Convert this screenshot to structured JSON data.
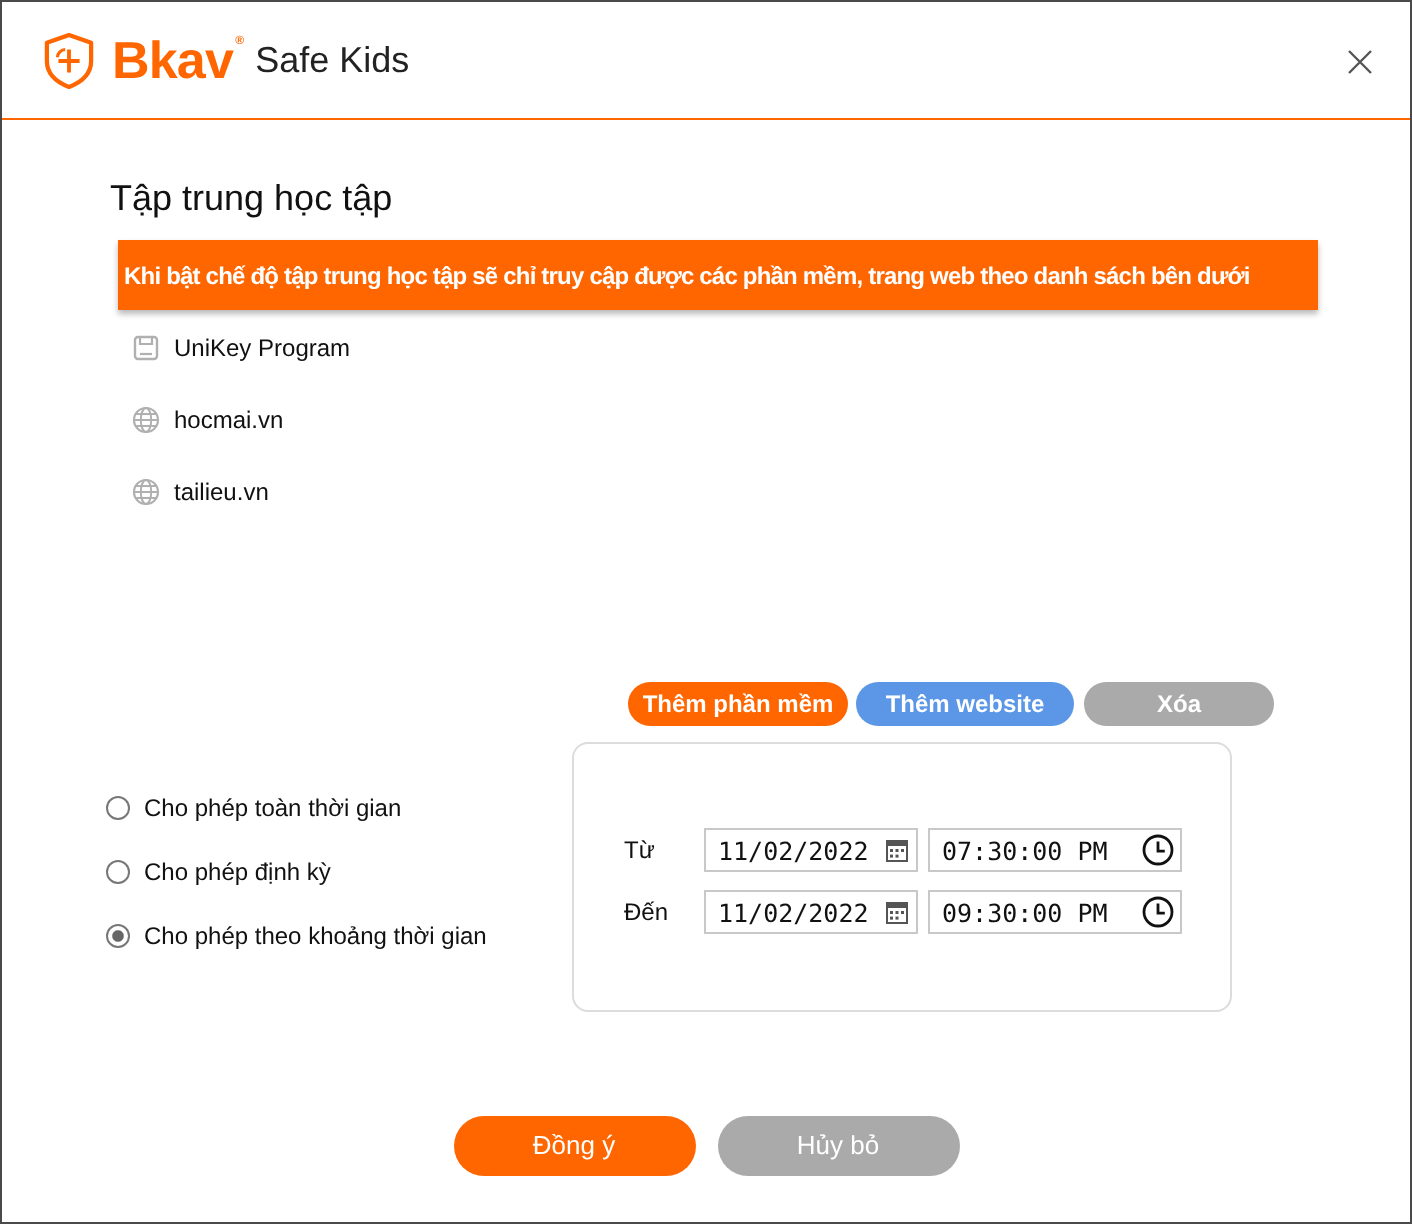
{
  "window": {
    "brand": "Bkav$^{®}$",
    "product": "Safe Kids"
  },
  "page": {
    "title": "Tập trung học tập",
    "notice": "Khi bật chế độ tập trung học tập sẽ chỉ truy cập được các phần mềm, trang web theo danh sách bên dưới"
  },
  "allowed_items": [
    {
      "kind": "program",
      "name": "UniKey Program"
    },
    {
      "kind": "website",
      "name": "hocmai.vn"
    },
    {
      "kind": "website",
      "name": "tailieu.vn"
    }
  ],
  "list_actions": [
    {
      "kind": "primary",
      "label": "Thêm phần mềm"
    },
    {
      "kind": "secondary",
      "label": "Thêm website"
    },
    {
      "kind": "neutral",
      "label": "Xóa"
    }
  ],
  "schedule_options": [
    {
      "label": "Cho phép toàn thời gian",
      "selected": false
    },
    {
      "label": "Cho phép định kỳ",
      "selected": false
    },
    {
      "label": "Cho phép theo khoảng thời gian",
      "selected": true
    }
  ],
  "time_range": [
    {
      "label": "Từ",
      "date": "11/02/2022",
      "time": "07:30:00 PM"
    },
    {
      "label": "Đến",
      "date": "11/02/2022",
      "time": "09:30:00 PM"
    }
  ],
  "buttons": [
    {
      "kind": "primary",
      "label": "Đồng ý"
    },
    {
      "kind": "neutral",
      "label": "Hủy bỏ"
    }
  ]
}
